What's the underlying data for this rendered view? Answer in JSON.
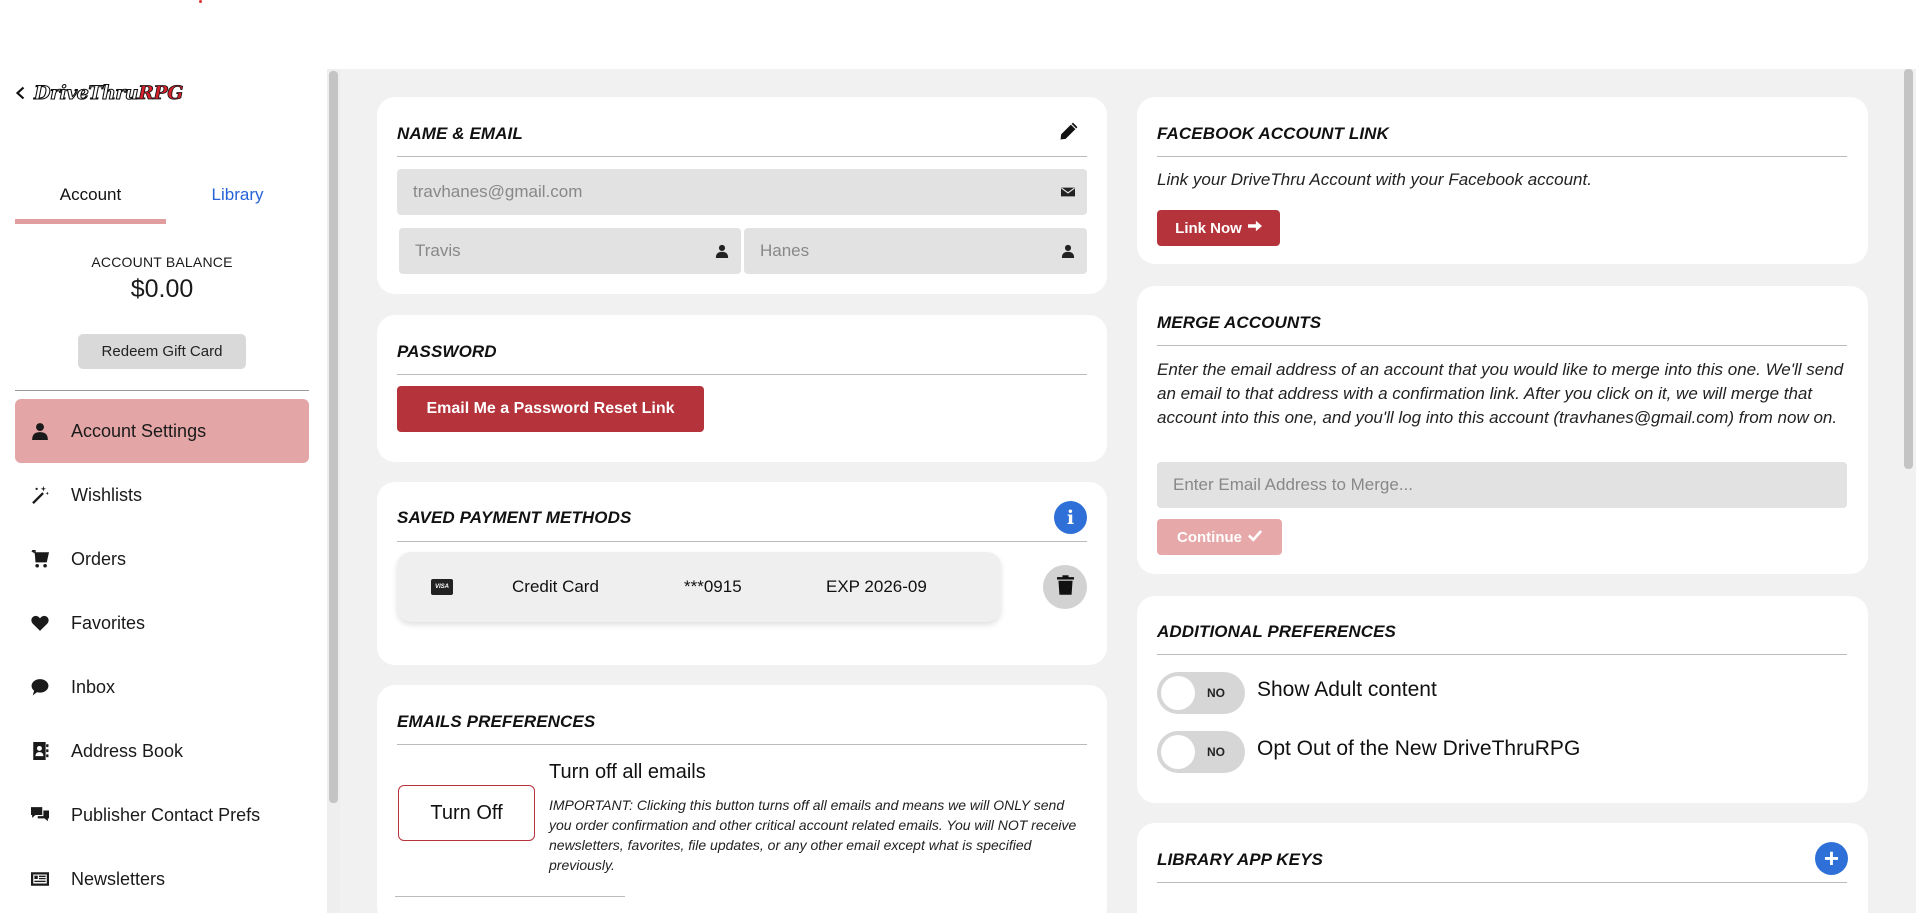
{
  "sidebar": {
    "logo_part1": "DriveThru",
    "logo_part2": "RPG",
    "tabs": [
      {
        "label": "Account"
      },
      {
        "label": "Library"
      }
    ],
    "balance_label": "ACCOUNT BALANCE",
    "balance_value": "$0.00",
    "redeem_label": "Redeem Gift Card",
    "nav": [
      {
        "label": "Account Settings",
        "icon": "user-icon",
        "active": true
      },
      {
        "label": "Wishlists",
        "icon": "magic-wand-icon"
      },
      {
        "label": "Orders",
        "icon": "cart-icon"
      },
      {
        "label": "Favorites",
        "icon": "heart-icon"
      },
      {
        "label": "Inbox",
        "icon": "chat-bubble-icon"
      },
      {
        "label": "Address Book",
        "icon": "address-book-icon"
      },
      {
        "label": "Publisher Contact Prefs",
        "icon": "comments-icon"
      },
      {
        "label": "Newsletters",
        "icon": "newspaper-icon"
      }
    ]
  },
  "name_email": {
    "title": "NAME & EMAIL",
    "email_placeholder": "travhanes@gmail.com",
    "first_name_placeholder": "Travis",
    "last_name_placeholder": "Hanes"
  },
  "password": {
    "title": "PASSWORD",
    "reset_button": "Email Me a Password Reset Link"
  },
  "payment": {
    "title": "SAVED PAYMENT METHODS",
    "method": {
      "brand": "VISA",
      "type": "Credit Card",
      "number": "***0915",
      "expiry": "EXP 2026-09"
    }
  },
  "emails": {
    "title": "EMAILS PREFERENCES",
    "turn_off_button": "Turn Off",
    "heading": "Turn off all emails",
    "notice": "IMPORTANT: Clicking this button turns off all emails and means we will ONLY send you order confirmation and other critical account related emails. You will NOT receive newsletters, favorites, file updates, or any other email except what is specified previously."
  },
  "facebook": {
    "title": "FACEBOOK ACCOUNT LINK",
    "description": "Link your DriveThru Account with your Facebook account.",
    "button": "Link Now"
  },
  "merge": {
    "title": "MERGE ACCOUNTS",
    "description": "Enter the email address of an account that you would like to merge into this one. We'll send an email to that address with a confirmation link. After you click on it, we will merge that account into this one, and you'll log into this account (travhanes@gmail.com) from now on.",
    "input_placeholder": "Enter Email Address to Merge...",
    "button": "Continue"
  },
  "preferences": {
    "title": "ADDITIONAL PREFERENCES",
    "toggles": [
      {
        "state": "NO",
        "label": "Show Adult content",
        "on": false
      },
      {
        "state": "NO",
        "label": "Opt Out of the New DriveThruRPG",
        "on": false
      }
    ]
  },
  "app_keys": {
    "title": "LIBRARY APP KEYS"
  },
  "colors": {
    "brand_red": "#b5333a",
    "active_nav": "#e4a5a6",
    "link_blue": "#2563d8",
    "info_blue": "#2e6fd8"
  }
}
